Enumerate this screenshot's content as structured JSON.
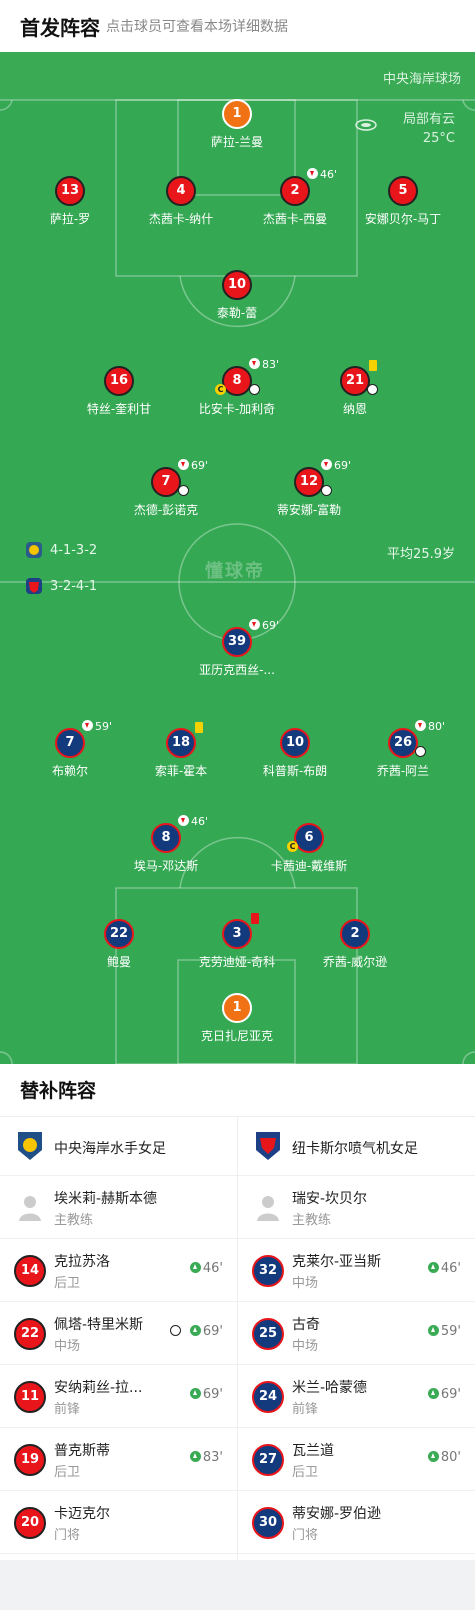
{
  "header": {
    "title": "首发阵容",
    "subtitle": "点击球员可查看本场详细数据"
  },
  "venue": "中央海岸球场",
  "weather": {
    "condition": "局部有云",
    "temp": "25°C"
  },
  "home": {
    "formation": "4-1-3-2",
    "avg_age": "平均25.9岁",
    "players": [
      {
        "num": "1",
        "name": "萨拉-兰曼"
      },
      {
        "num": "13",
        "name": "萨拉-罗"
      },
      {
        "num": "4",
        "name": "杰茜卡-纳什"
      },
      {
        "num": "2",
        "name": "杰茜卡-西曼",
        "sub": "46'"
      },
      {
        "num": "5",
        "name": "安娜贝尔-马丁"
      },
      {
        "num": "10",
        "name": "泰勒-蕾"
      },
      {
        "num": "16",
        "name": "特丝-奎利甘"
      },
      {
        "num": "8",
        "name": "比安卡-加利奇",
        "sub": "83'",
        "captain": "C"
      },
      {
        "num": "21",
        "name": "纳恩"
      },
      {
        "num": "7",
        "name": "杰德-彭诺克",
        "sub": "69'"
      },
      {
        "num": "12",
        "name": "蒂安娜-富勒",
        "sub": "69'"
      }
    ]
  },
  "away": {
    "formation": "3-2-4-1",
    "players": [
      {
        "num": "39",
        "name": "亚历克西丝-...",
        "sub": "69'"
      },
      {
        "num": "7",
        "name": "布赖尔",
        "sub": "59'"
      },
      {
        "num": "18",
        "name": "索菲-霍本"
      },
      {
        "num": "10",
        "name": "科普斯-布朗"
      },
      {
        "num": "26",
        "name": "乔茜-阿兰",
        "sub": "80'"
      },
      {
        "num": "8",
        "name": "埃马-邓达斯",
        "sub": "46'"
      },
      {
        "num": "6",
        "name": "卡茜迪-戴维斯",
        "captain": "C"
      },
      {
        "num": "22",
        "name": "鲍曼"
      },
      {
        "num": "3",
        "name": "克劳迪娅-奇科"
      },
      {
        "num": "2",
        "name": "乔茜-威尔逊"
      },
      {
        "num": "1",
        "name": "克日扎尼亚克"
      }
    ]
  },
  "watermark": "懂球帝",
  "bench": {
    "title": "替补阵容",
    "home_team": "中央海岸水手女足",
    "away_team": "纽卡斯尔喷气机女足",
    "home_coach": {
      "name": "埃米莉-赫斯本德",
      "role": "主教练"
    },
    "away_coach": {
      "name": "瑞安-坎贝尔",
      "role": "主教练"
    },
    "home_subs": [
      {
        "num": "14",
        "name": "克拉苏洛",
        "pos": "后卫",
        "time": "46'"
      },
      {
        "num": "22",
        "name": "佩塔-特里米斯",
        "pos": "中场",
        "time": "69'"
      },
      {
        "num": "11",
        "name": "安纳莉丝-拉...",
        "pos": "前锋",
        "time": "69'"
      },
      {
        "num": "19",
        "name": "普克斯蒂",
        "pos": "后卫",
        "time": "83'"
      },
      {
        "num": "20",
        "name": "卡迈克尔",
        "pos": "门将",
        "time": ""
      }
    ],
    "away_subs": [
      {
        "num": "32",
        "name": "克莱尔-亚当斯",
        "pos": "中场",
        "time": "46'"
      },
      {
        "num": "25",
        "name": "古奇",
        "pos": "中场",
        "time": "59'"
      },
      {
        "num": "24",
        "name": "米兰-哈蒙德",
        "pos": "前锋",
        "time": "69'"
      },
      {
        "num": "27",
        "name": "瓦兰道",
        "pos": "后卫",
        "time": "80'"
      },
      {
        "num": "30",
        "name": "蒂安娜-罗伯逊",
        "pos": "门将",
        "time": ""
      }
    ]
  }
}
